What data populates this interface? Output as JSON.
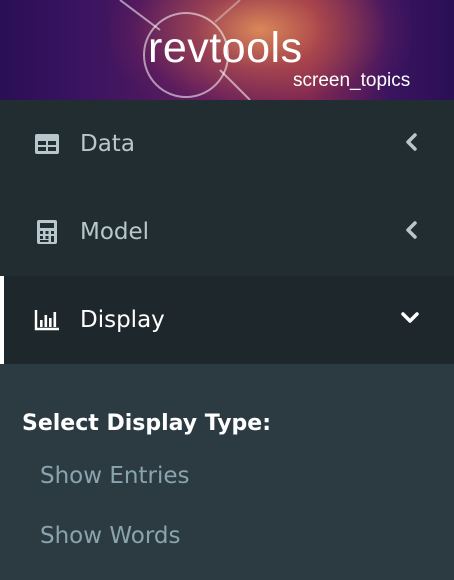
{
  "banner": {
    "logo_text": "revtools",
    "subtitle": "screen_topics"
  },
  "sidebar": {
    "items": [
      {
        "label": "Data",
        "icon": "table-icon",
        "caret": "chevron-left-icon",
        "expanded": false
      },
      {
        "label": "Model",
        "icon": "calculator-icon",
        "caret": "chevron-left-icon",
        "expanded": false
      },
      {
        "label": "Display",
        "icon": "bar-chart-icon",
        "caret": "chevron-down-icon",
        "expanded": true
      }
    ]
  },
  "display_panel": {
    "heading": "Select Display Type:",
    "options": [
      "Show Entries",
      "Show Words"
    ]
  },
  "colors": {
    "sidebar_bg": "#222d32",
    "active_item_bg": "#1e282c",
    "submenu_bg": "#2c3b41",
    "text_muted": "#b8c7ce",
    "option_text": "#8aa4af"
  }
}
